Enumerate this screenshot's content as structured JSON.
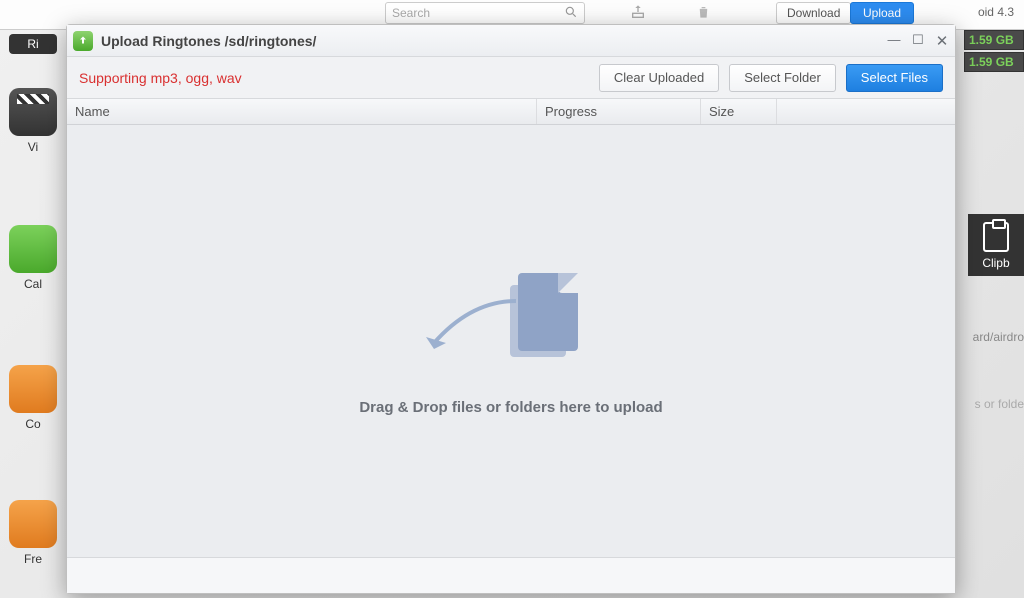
{
  "top": {
    "search_placeholder": "Search",
    "download_label": "Download",
    "upload_label": "Upload",
    "os_label": "oid 4.3"
  },
  "storage": {
    "row1": "1.59 GB",
    "row2": "1.59 GB"
  },
  "right": {
    "clipboard_label": "Clipb",
    "path_fragment": "ard/airdro",
    "hint_fragment": "s or folde"
  },
  "sidebar": {
    "ri_label": "Ri",
    "videos_label": "Vi",
    "call_label": "Cal",
    "contacts_label": "Co",
    "free_label": "Fre"
  },
  "dialog": {
    "title": "Upload Ringtones /sd/ringtones/",
    "support_text": "Supporting mp3, ogg, wav",
    "buttons": {
      "clear_uploaded": "Clear Uploaded",
      "select_folder": "Select Folder",
      "select_files": "Select Files"
    },
    "columns": {
      "name": "Name",
      "progress": "Progress",
      "size": "Size"
    },
    "drop_text": "Drag & Drop files or folders here to upload"
  }
}
